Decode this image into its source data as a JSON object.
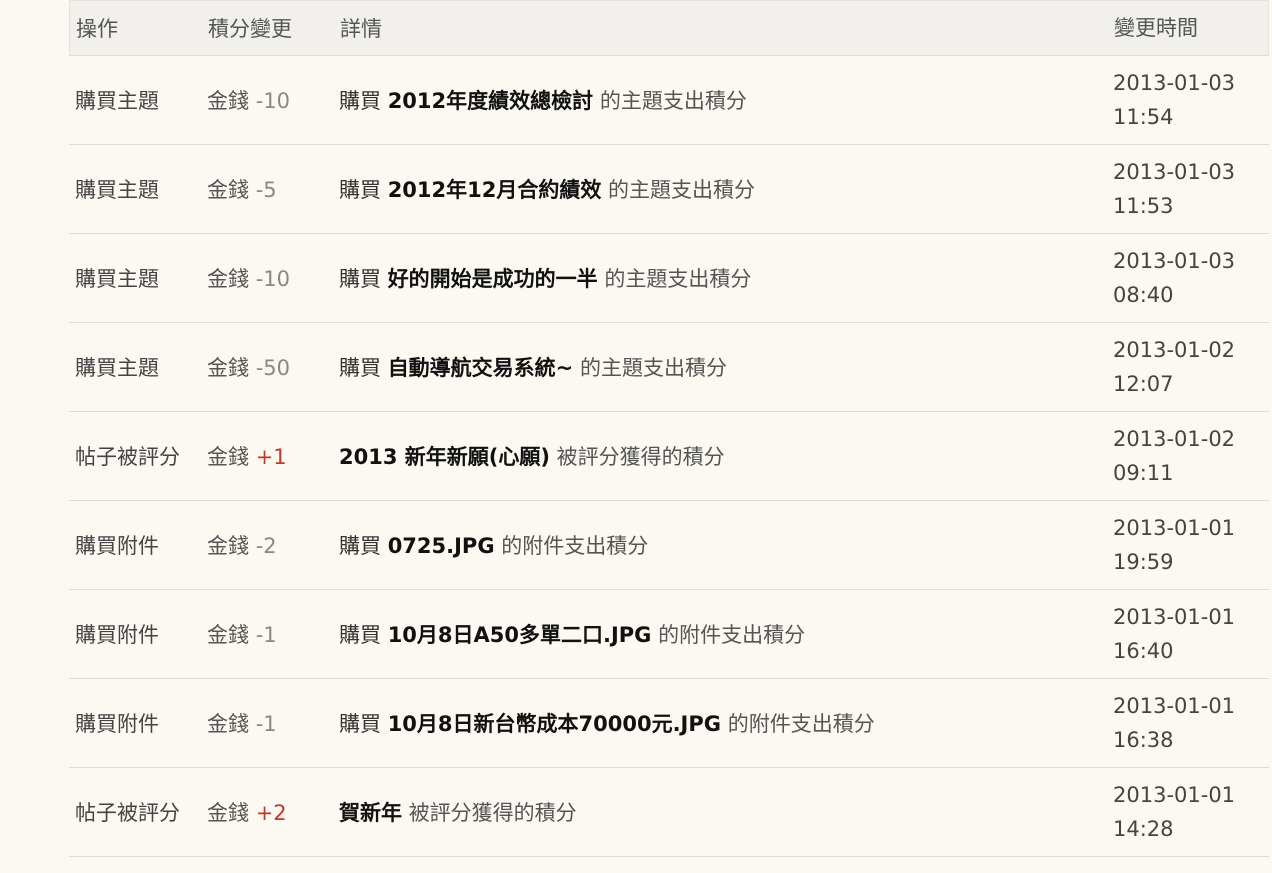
{
  "table": {
    "headers": {
      "operation": "操作",
      "change": "積分變更",
      "detail": "詳情",
      "time": "變更時間"
    },
    "rows": [
      {
        "operation": "購買主題",
        "currency": "金錢",
        "amount": "-10",
        "amount_sign": "negative",
        "detail_prefix": "購買",
        "detail_title": "2012年度績效總檢討",
        "detail_suffix": "的主題支出積分",
        "date": "2013-01-03",
        "time": "11:54"
      },
      {
        "operation": "購買主題",
        "currency": "金錢",
        "amount": "-5",
        "amount_sign": "negative",
        "detail_prefix": "購買",
        "detail_title": "2012年12月合約績效",
        "detail_suffix": "的主題支出積分",
        "date": "2013-01-03",
        "time": "11:53"
      },
      {
        "operation": "購買主題",
        "currency": "金錢",
        "amount": "-10",
        "amount_sign": "negative",
        "detail_prefix": "購買",
        "detail_title": "好的開始是成功的一半",
        "detail_suffix": "的主題支出積分",
        "date": "2013-01-03",
        "time": "08:40"
      },
      {
        "operation": "購買主題",
        "currency": "金錢",
        "amount": "-50",
        "amount_sign": "negative",
        "detail_prefix": "購買",
        "detail_title": "自動導航交易系統~",
        "detail_suffix": "的主題支出積分",
        "date": "2013-01-02",
        "time": "12:07"
      },
      {
        "operation": "帖子被評分",
        "currency": "金錢",
        "amount": "+1",
        "amount_sign": "positive",
        "detail_prefix": "",
        "detail_title": "2013 新年新願(心願)",
        "detail_suffix": "被評分獲得的積分",
        "date": "2013-01-02",
        "time": "09:11"
      },
      {
        "operation": "購買附件",
        "currency": "金錢",
        "amount": "-2",
        "amount_sign": "negative",
        "detail_prefix": "購買",
        "detail_title": "0725.JPG",
        "detail_suffix": "的附件支出積分",
        "date": "2013-01-01",
        "time": "19:59"
      },
      {
        "operation": "購買附件",
        "currency": "金錢",
        "amount": "-1",
        "amount_sign": "negative",
        "detail_prefix": "購買",
        "detail_title": "10月8日A50多單二口.JPG",
        "detail_suffix": "的附件支出積分",
        "date": "2013-01-01",
        "time": "16:40"
      },
      {
        "operation": "購買附件",
        "currency": "金錢",
        "amount": "-1",
        "amount_sign": "negative",
        "detail_prefix": "購買",
        "detail_title": "10月8日新台幣成本70000元.JPG",
        "detail_suffix": "的附件支出積分",
        "date": "2013-01-01",
        "time": "16:38"
      },
      {
        "operation": "帖子被評分",
        "currency": "金錢",
        "amount": "+2",
        "amount_sign": "positive",
        "detail_prefix": "",
        "detail_title": "賀新年",
        "detail_suffix": "被評分獲得的積分",
        "date": "2013-01-01",
        "time": "14:28"
      }
    ]
  },
  "colors": {
    "background": "#fbf9f1",
    "header_background": "#f1f0ec",
    "positive_amount": "#c0392b",
    "negative_amount": "#888888"
  }
}
